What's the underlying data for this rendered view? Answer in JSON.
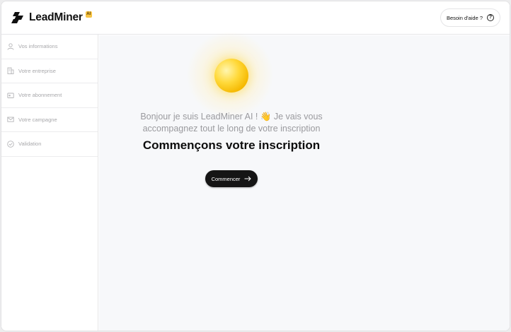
{
  "header": {
    "logo_text": "LeadMiner",
    "ai_badge": "AI",
    "help_label": "Besoin d'aide ?",
    "help_icon": "question-circle-icon"
  },
  "sidebar": {
    "items": [
      {
        "label": "Vos informations",
        "icon": "user-icon"
      },
      {
        "label": "Votre entreprise",
        "icon": "building-icon"
      },
      {
        "label": "Votre abonnement",
        "icon": "card-icon"
      },
      {
        "label": "Votre campagne",
        "icon": "mail-icon"
      },
      {
        "label": "Validation",
        "icon": "check-circle-icon"
      }
    ]
  },
  "main": {
    "intro_line1": "Bonjour je suis LeadMiner AI ! 👋 Je vais vous",
    "intro_line2": "accompagnez tout le long de votre inscription",
    "headline": "Commençons votre inscription",
    "start_label": "Commencer",
    "start_icon": "arrow-right-icon"
  },
  "colors": {
    "accent_dark": "#151515",
    "sun_yellow": "#ffd93a",
    "badge_yellow": "#f6c343"
  }
}
